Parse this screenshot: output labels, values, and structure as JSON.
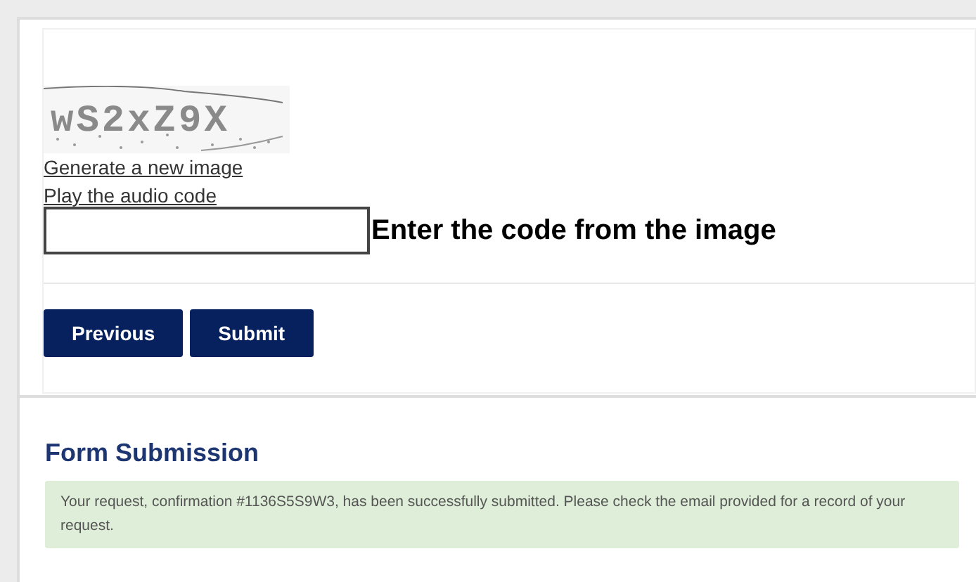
{
  "captcha": {
    "code": "wS2xZ9X",
    "links": [
      "Generate a new image",
      "Play the audio code"
    ],
    "input_label": "Enter the code from the image"
  },
  "buttons": [
    {
      "label": "Previous"
    },
    {
      "label": "Submit"
    }
  ],
  "result": {
    "title": "Form Submission",
    "message": "Your request, confirmation #1136S5S9W3, has been successfully submitted. Please check the email provided for a record of your request."
  }
}
